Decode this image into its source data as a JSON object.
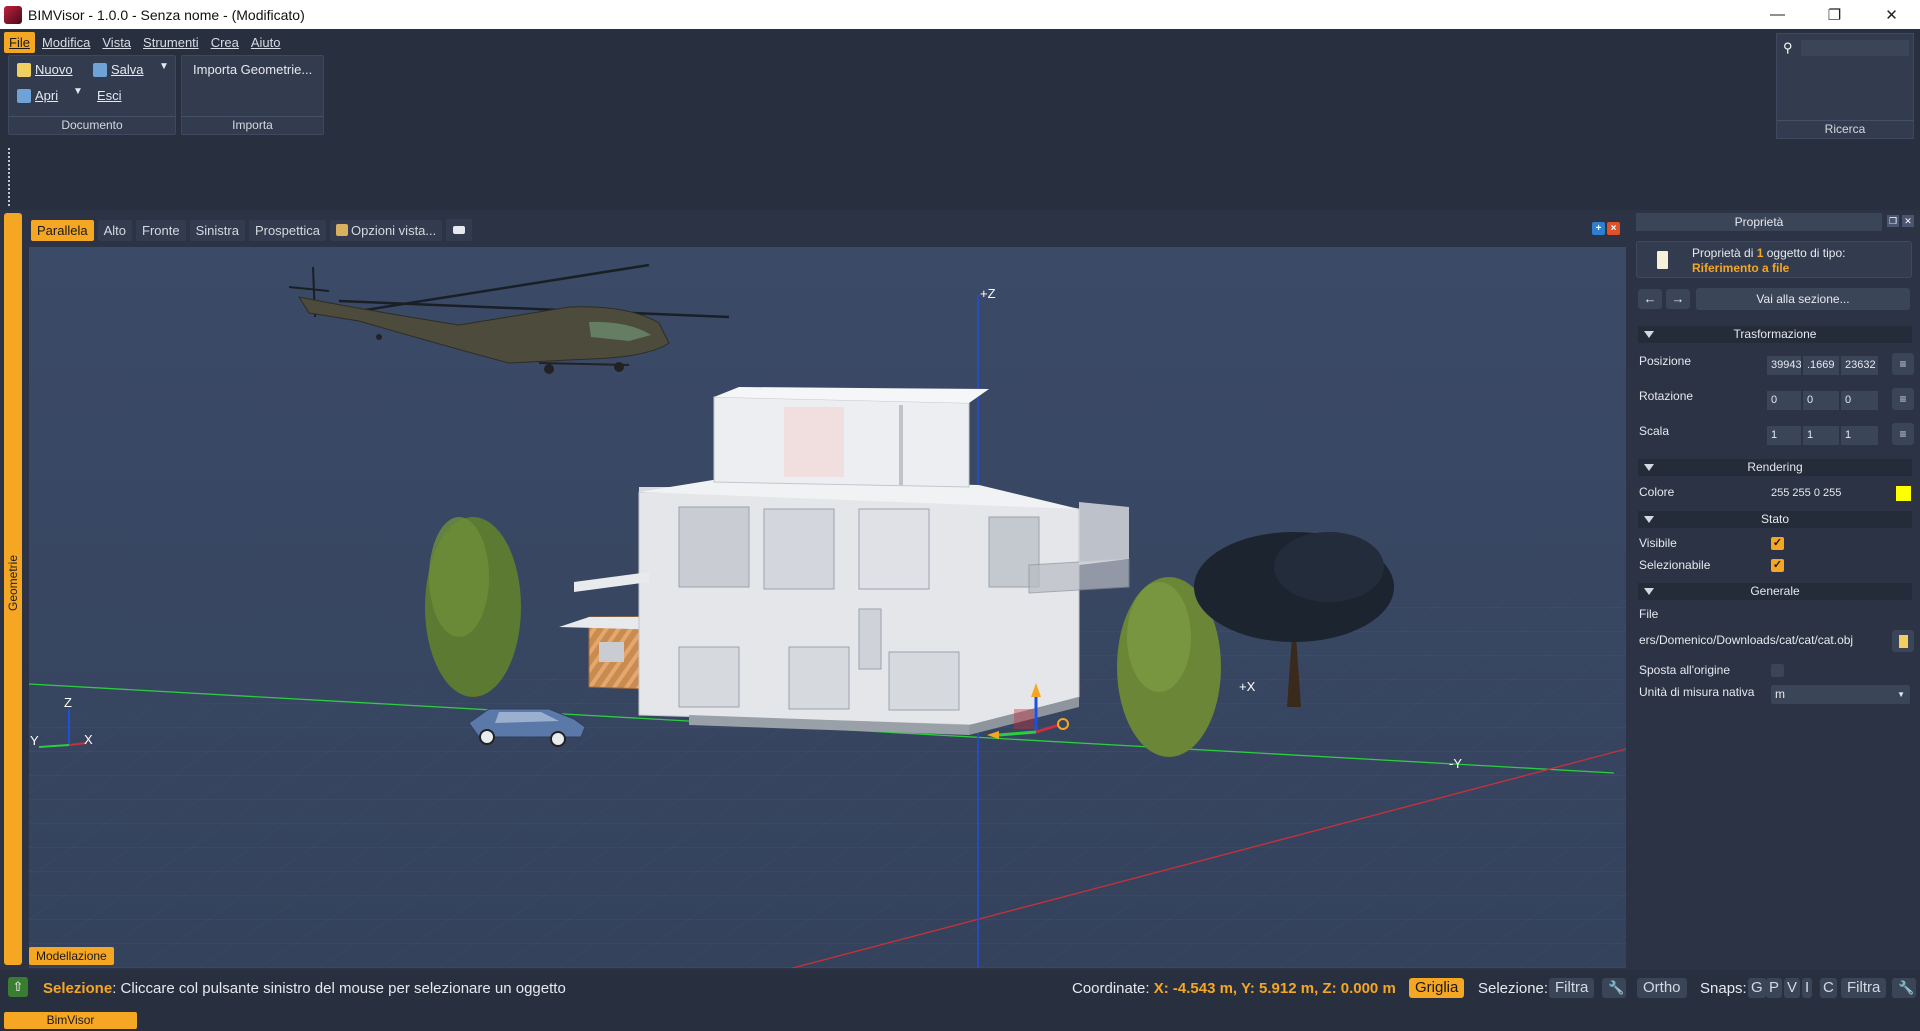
{
  "window": {
    "title": "BIMVisor - 1.0.0 - Senza nome - (Modificato)",
    "controls": [
      "minimize-icon",
      "restore-icon",
      "close-icon"
    ]
  },
  "menu": [
    "File",
    "Modifica",
    "Vista",
    "Strumenti",
    "Crea",
    "Aiuto"
  ],
  "ribbon": {
    "documento": {
      "nuovo": "Nuovo",
      "salva": "Salva",
      "apri": "Apri",
      "esci": "Esci",
      "footer": "Documento"
    },
    "importa": {
      "geometrie": "Importa Geometrie...",
      "footer": "Importa"
    },
    "ricerca": {
      "footer": "Ricerca",
      "placeholder": ""
    }
  },
  "side_tab": "Geometrie",
  "view_tabs": [
    "Parallela",
    "Alto",
    "Fronte",
    "Sinistra",
    "Prospettica"
  ],
  "view_options": "Opzioni vista...",
  "scene": {
    "axis_labels": {
      "z_plus": "+Z",
      "x_plus": "+X",
      "y_minus": "-Y"
    },
    "gizmo": {
      "z": "Z",
      "y": "Y",
      "x": "X"
    },
    "colors": {
      "background": "#3a4966",
      "x_axis": "#c8303a",
      "y_axis": "#2ecc40",
      "z_axis": "#1f4fe0",
      "accent": "#f5a623"
    }
  },
  "mode_tab": "Modellazione",
  "properties": {
    "title": "Proprietà",
    "header_prefix": "Proprietà di ",
    "header_count": "1",
    "header_suffix": " oggetto di tipo:",
    "object_type": "Riferimento a file",
    "goto": "Vai alla sezione...",
    "sections": {
      "trasformazione": "Trasformazione",
      "rendering": "Rendering",
      "stato": "Stato",
      "generale": "Generale"
    },
    "posizione": {
      "label": "Posizione",
      "values": [
        "39943",
        ".1669",
        "23632"
      ]
    },
    "rotazione": {
      "label": "Rotazione",
      "values": [
        "0",
        "0",
        "0"
      ]
    },
    "scala": {
      "label": "Scala",
      "values": [
        "1",
        "1",
        "1"
      ]
    },
    "colore": {
      "label": "Colore",
      "value": "255 255 0 255",
      "swatch": "#ffff00"
    },
    "visibile": {
      "label": "Visibile",
      "checked": true
    },
    "selezionabile": {
      "label": "Selezionabile",
      "checked": true
    },
    "file": {
      "label": "File",
      "value": "ers/Domenico/Downloads/cat/cat/cat.obj"
    },
    "sposta": {
      "label": "Sposta all'origine",
      "checked": false
    },
    "unita": {
      "label": "Unità di misura nativa",
      "value": "m"
    }
  },
  "status": {
    "mode": "Selezione",
    "message": ": Cliccare col pulsante sinistro del mouse per selezionare un oggetto",
    "coord_label": "Coordinate: ",
    "coord_value": "X: -4.543 m, Y: 5.912 m, Z: 0.000 m",
    "griglia": "Griglia",
    "selezione_label": "Selezione:",
    "filtra": "Filtra",
    "ortho": "Ortho",
    "snaps_label": "Snaps:",
    "snaps": [
      "G",
      "P",
      "V",
      "I",
      "C"
    ],
    "filtra2": "Filtra"
  },
  "bottom_tab": "BimVisor"
}
